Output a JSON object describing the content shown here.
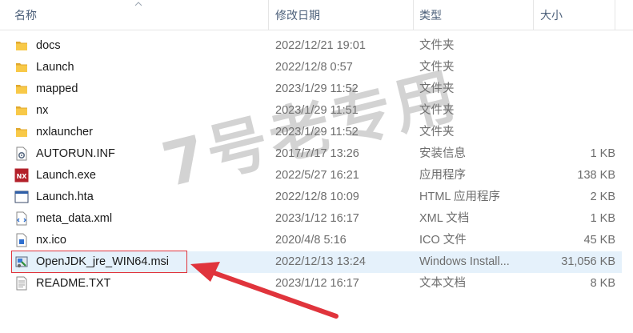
{
  "header": {
    "name": "名称",
    "date": "修改日期",
    "type": "类型",
    "size": "大小"
  },
  "files": [
    {
      "icon": "folder-icon",
      "name": "docs",
      "date": "2022/12/21 19:01",
      "type": "文件夹",
      "size": ""
    },
    {
      "icon": "folder-icon",
      "name": "Launch",
      "date": "2022/12/8 0:57",
      "type": "文件夹",
      "size": ""
    },
    {
      "icon": "folder-icon",
      "name": "mapped",
      "date": "2023/1/29 11:52",
      "type": "文件夹",
      "size": ""
    },
    {
      "icon": "folder-icon",
      "name": "nx",
      "date": "2023/1/29 11:51",
      "type": "文件夹",
      "size": ""
    },
    {
      "icon": "folder-icon",
      "name": "nxlauncher",
      "date": "2023/1/29 11:52",
      "type": "文件夹",
      "size": ""
    },
    {
      "icon": "settings-file-icon",
      "name": "AUTORUN.INF",
      "date": "2017/7/17 13:26",
      "type": "安装信息",
      "size": "1 KB"
    },
    {
      "icon": "nx-app-icon",
      "name": "Launch.exe",
      "date": "2022/5/27 16:21",
      "type": "应用程序",
      "size": "138 KB"
    },
    {
      "icon": "hta-file-icon",
      "name": "Launch.hta",
      "date": "2022/12/8 10:09",
      "type": "HTML 应用程序",
      "size": "2 KB"
    },
    {
      "icon": "xml-file-icon",
      "name": "meta_data.xml",
      "date": "2023/1/12 16:17",
      "type": "XML 文档",
      "size": "1 KB"
    },
    {
      "icon": "image-file-icon",
      "name": "nx.ico",
      "date": "2020/4/8 5:16",
      "type": "ICO 文件",
      "size": "45 KB"
    },
    {
      "icon": "msi-installer-icon",
      "name": "OpenJDK_jre_WIN64.msi",
      "date": "2022/12/13 13:24",
      "type": "Windows Install...",
      "size": "31,056 KB"
    },
    {
      "icon": "text-file-icon",
      "name": "README.TXT",
      "date": "2023/1/12 16:17",
      "type": "文本文档",
      "size": "8 KB"
    }
  ],
  "highlighted_index": 10,
  "watermark": "7号老专用",
  "colors": {
    "header_text": "#4c607a",
    "highlight_bg": "#e5f1fb",
    "annotation_red": "#e0343c",
    "folder_yellow": "#f8c948"
  }
}
